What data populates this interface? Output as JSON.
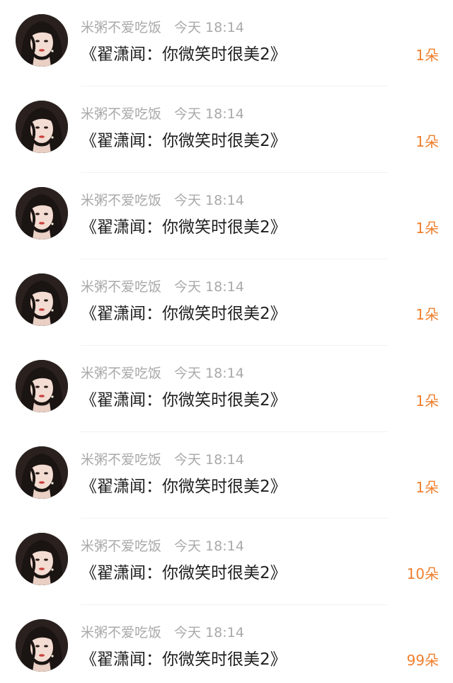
{
  "items": [
    {
      "user": "米粥不爱吃饭",
      "time": "今天 18:14",
      "title": "《翟潇闻：你微笑时很美2》",
      "count": "1朵"
    },
    {
      "user": "米粥不爱吃饭",
      "time": "今天 18:14",
      "title": "《翟潇闻：你微笑时很美2》",
      "count": "1朵"
    },
    {
      "user": "米粥不爱吃饭",
      "time": "今天 18:14",
      "title": "《翟潇闻：你微笑时很美2》",
      "count": "1朵"
    },
    {
      "user": "米粥不爱吃饭",
      "time": "今天 18:14",
      "title": "《翟潇闻：你微笑时很美2》",
      "count": "1朵"
    },
    {
      "user": "米粥不爱吃饭",
      "time": "今天 18:14",
      "title": "《翟潇闻：你微笑时很美2》",
      "count": "1朵"
    },
    {
      "user": "米粥不爱吃饭",
      "time": "今天 18:14",
      "title": "《翟潇闻：你微笑时很美2》",
      "count": "1朵"
    },
    {
      "user": "米粥不爱吃饭",
      "time": "今天 18:14",
      "title": "《翟潇闻：你微笑时很美2》",
      "count": "10朵"
    },
    {
      "user": "米粥不爱吃饭",
      "time": "今天 18:14",
      "title": "《翟潇闻：你微笑时很美2》",
      "count": "99朵"
    }
  ],
  "colors": {
    "count": "#f07f2d",
    "meta": "#a9a9a9",
    "title": "#1e1e1e"
  }
}
